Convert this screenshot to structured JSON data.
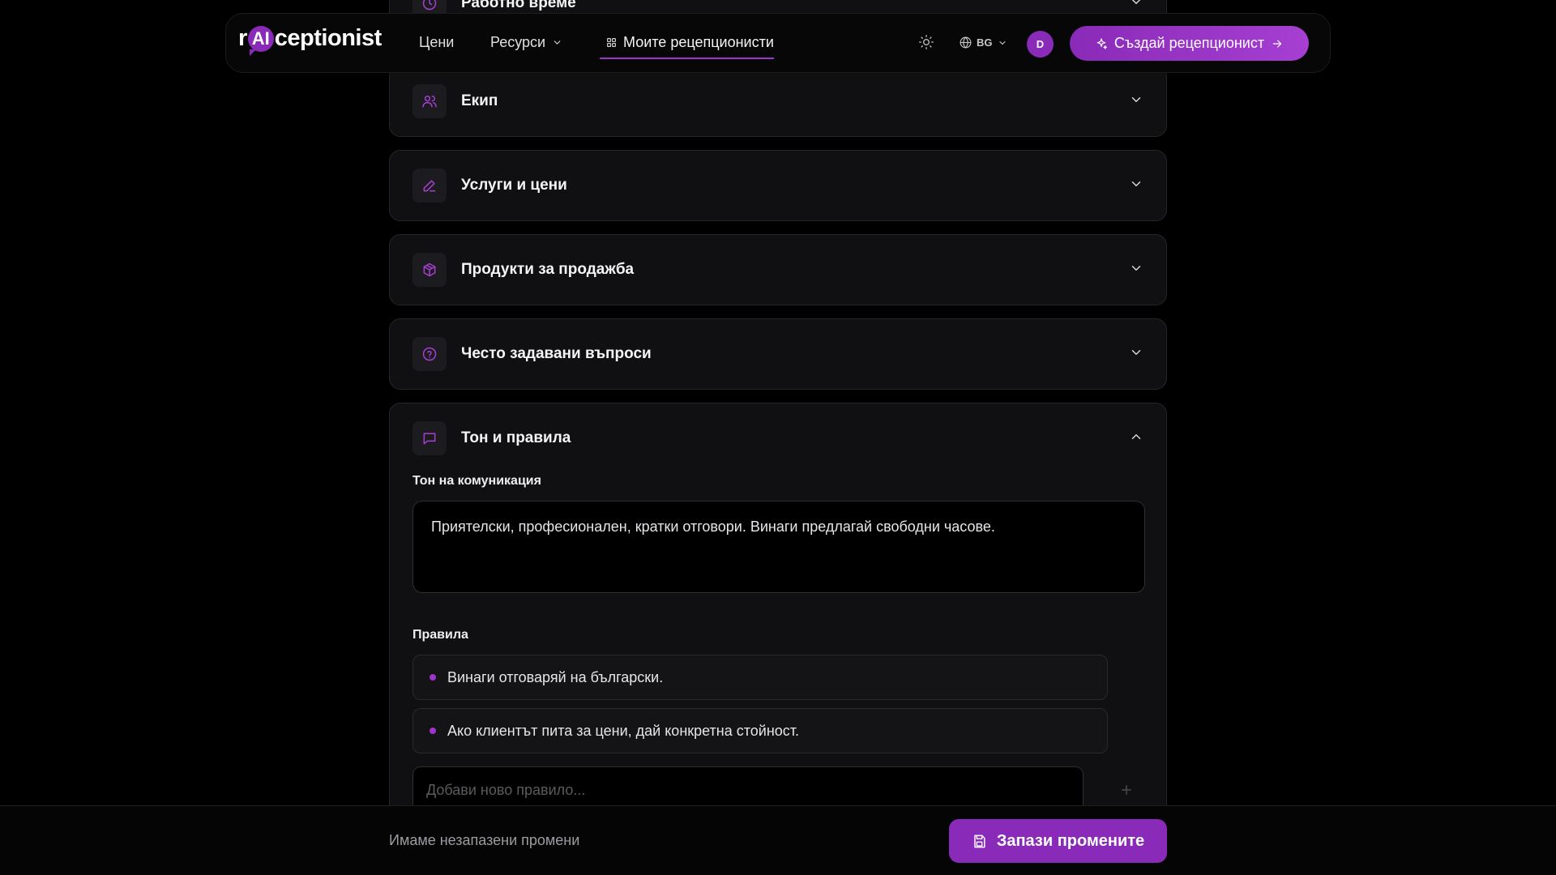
{
  "header": {
    "logo_prefix": "r",
    "logo_ai": "AI",
    "logo_suffix": "ceptionist",
    "nav": {
      "pricing": "Цени",
      "resources": "Ресурси",
      "my_receptionists": "Моите рецепционисти"
    },
    "language": "BG",
    "avatar_initial": "D",
    "create_button": "Създай рецепционист"
  },
  "sections": [
    {
      "title": "Работно време",
      "icon": "clock-icon"
    },
    {
      "title": "Екип",
      "icon": "users-icon"
    },
    {
      "title": "Услуги и цени",
      "icon": "pencil-icon"
    },
    {
      "title": "Продукти за продажба",
      "icon": "box-icon"
    },
    {
      "title": "Често задавани въпроси",
      "icon": "help-circle-icon"
    },
    {
      "title": "Тон и правила",
      "icon": "message-square-icon"
    }
  ],
  "tone_section": {
    "tone_label": "Тон на комуникация",
    "tone_value": "Приятелски, професионален, кратки отговори. Винаги предлагай свободни часове.",
    "rules_label": "Правила",
    "rules": [
      "Винаги отговаряй на български.",
      "Ако клиентът пита за цени, дай конкретна стойност."
    ],
    "new_rule_placeholder": "Добави ново правило..."
  },
  "footer": {
    "unsaved_text": "Имаме незапазени промени",
    "save_button": "Запази промените"
  },
  "colors": {
    "accent": "#8a2ab8",
    "accent_light": "#a63fd2",
    "background": "#000000",
    "card": "#101012"
  }
}
